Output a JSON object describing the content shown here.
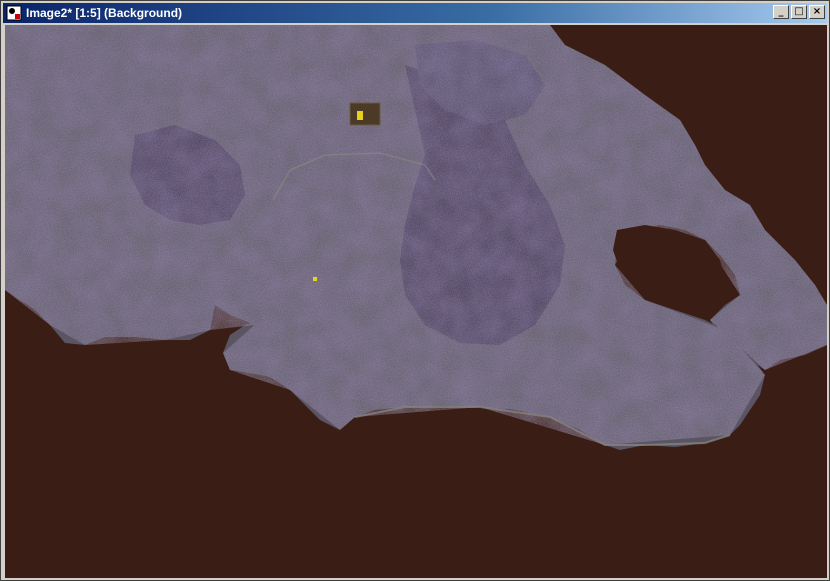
{
  "window": {
    "title": "Image2* [1:5] (Background)",
    "controls": {
      "minimize_glyph": "_",
      "maximize_glyph": "□",
      "close_glyph": "×"
    }
  },
  "image": {
    "description_icon": "satellite-image",
    "colors": {
      "sea": "#3a1e15",
      "land": "#5a5463",
      "highland": "#3f3451",
      "coast": "#8a8a84",
      "highlight": "#e6d21c"
    }
  }
}
